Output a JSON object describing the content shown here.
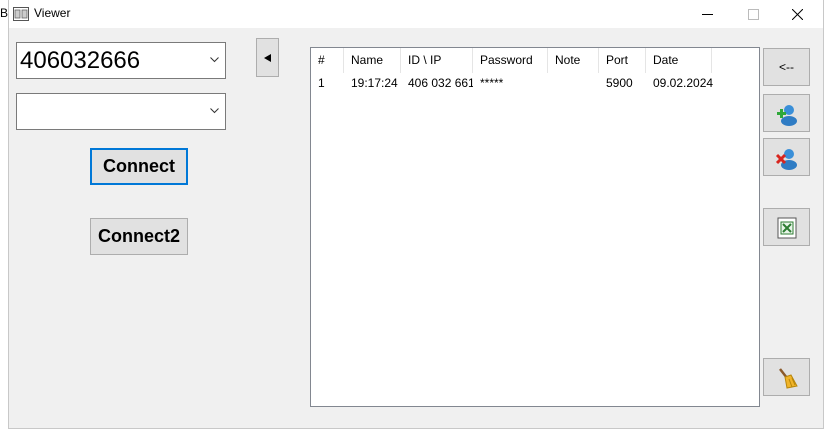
{
  "corner_letter": "B",
  "window": {
    "title": "Viewer"
  },
  "id_combo": {
    "value": "406032666"
  },
  "second_combo": {
    "value": ""
  },
  "buttons": {
    "connect": "Connect",
    "connect2": "Connect2"
  },
  "toggle": {
    "icon": "triangle-left-icon"
  },
  "history": {
    "columns": [
      "#",
      "Name",
      "ID \\ IP",
      "Password",
      "Note",
      "Port",
      "Date"
    ],
    "rows": [
      {
        "num": "1",
        "name": "19:17:24",
        "id": "406 032 661",
        "password": "*****",
        "note": "",
        "port": "5900",
        "date": "09.02.2024"
      }
    ]
  },
  "side_buttons": {
    "back": "<--",
    "add_icon": "add-user-icon",
    "remove_icon": "remove-user-icon",
    "export_icon": "excel-export-icon",
    "clear_icon": "broom-icon"
  },
  "colors": {
    "focus_border": "#0078d7",
    "window_bg": "#f0f0f0"
  }
}
